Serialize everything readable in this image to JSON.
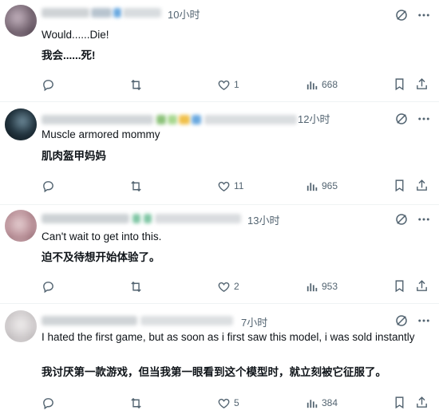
{
  "replies": [
    {
      "time": "10小时",
      "text_en": "Would......Die!",
      "text_zh": "我会......死!",
      "likes": "1",
      "views": "668",
      "avatar_color": "#8a7a86",
      "name_colors": [
        "#cfd3d6",
        "#b8c4cf",
        "#6aa9e0"
      ]
    },
    {
      "time": "12小时",
      "text_en": "Muscle armored mommy",
      "text_zh": "肌肉盔甲妈妈",
      "likes": "11",
      "views": "965",
      "avatar_color": "#1c2a33",
      "name_colors": [
        "#d2d6d9",
        "#8cc27a",
        "#f0c04a",
        "#6aa9e0"
      ]
    },
    {
      "time": "13小时",
      "text_en": "Can't wait to get into this.",
      "text_zh": "迫不及待想开始体验了。",
      "likes": "2",
      "views": "953",
      "avatar_color": "#c9a8ae",
      "name_colors": [
        "#cdd2d5",
        "#7fc6a4",
        "#cdd2d5"
      ]
    },
    {
      "time": "7小时",
      "text_en": "I hated the first game, but as soon as i first saw this model, i was sold instantly",
      "text_zh": "我讨厌第一款游戏，但当我第一眼看到这个模型时，就立刻被它征服了。",
      "likes": "5",
      "views": "384",
      "avatar_color": "#d6d3d4",
      "name_colors": [
        "#d0d4d7",
        "#dcdfe1"
      ]
    }
  ]
}
